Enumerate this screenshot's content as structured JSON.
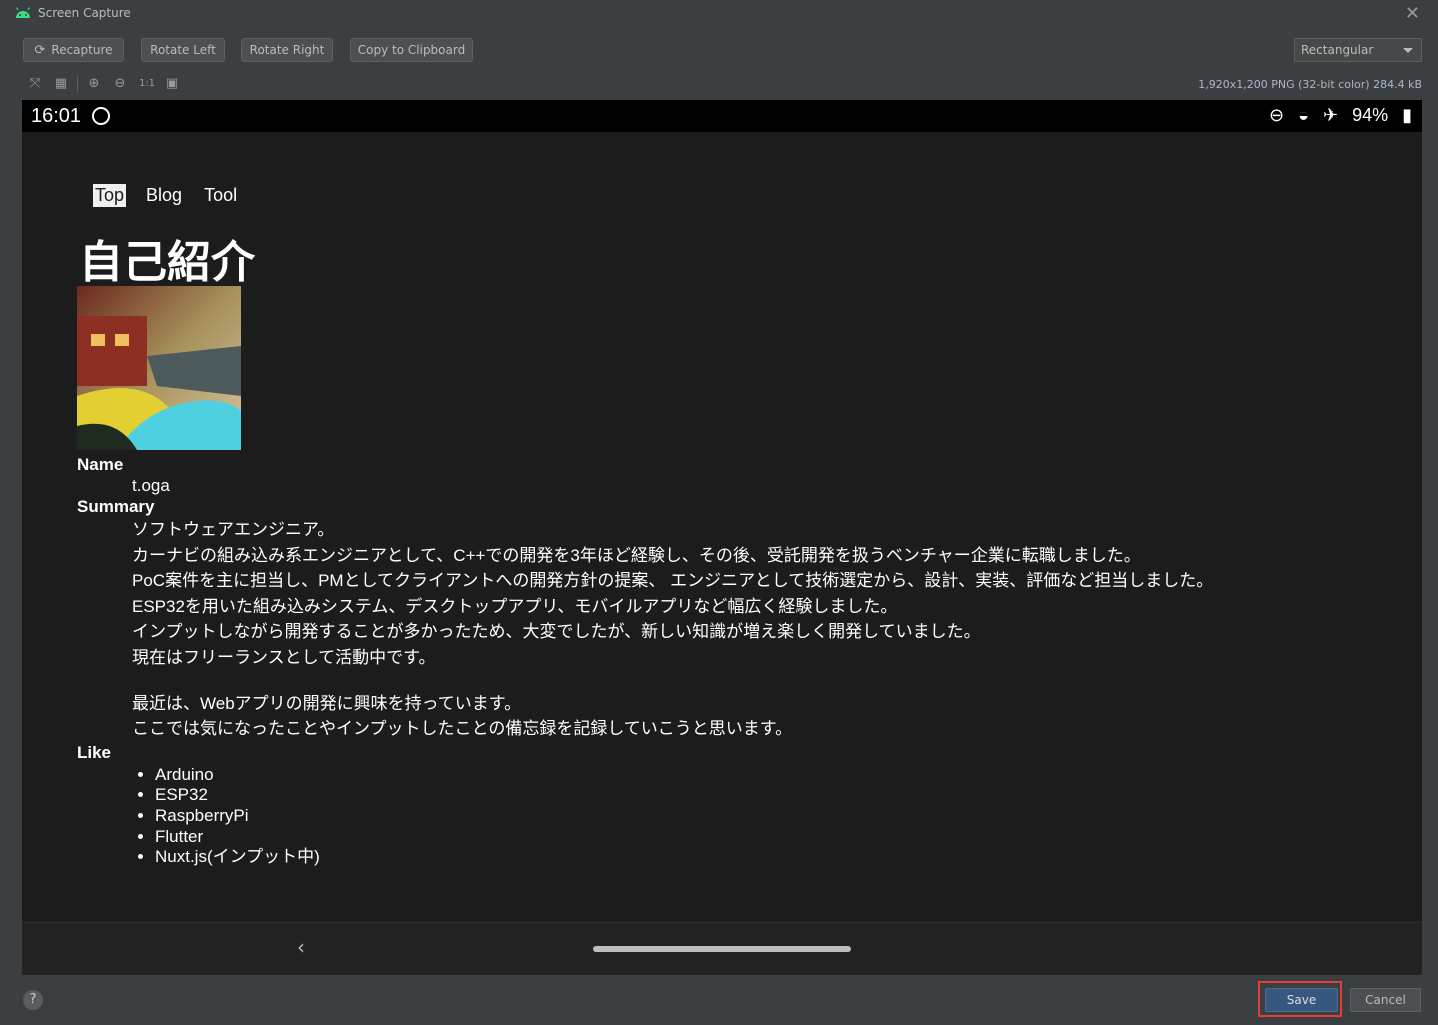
{
  "window": {
    "title": "Screen Capture",
    "close_glyph": "✕"
  },
  "toolbar": {
    "recapture_label": "Recapture",
    "rotate_left_label": "Rotate Left",
    "rotate_right_label": "Rotate Right",
    "copy_label": "Copy to Clipboard",
    "shape_select_value": "Rectangular"
  },
  "subtoolbar": {
    "icons": [
      "fit-screen-icon",
      "grid-icon",
      "zoom-in-icon",
      "zoom-out-icon",
      "actual-size-icon",
      "frame-icon"
    ],
    "actual_size_label": "1:1",
    "image_info": "1,920x1,200 PNG (32-bit color) 284.4 kB"
  },
  "device": {
    "status_bar": {
      "time": "16:01",
      "battery": "94%",
      "icons": [
        "dnd-icon",
        "wifi-icon",
        "airplane-icon",
        "battery-icon"
      ]
    },
    "page": {
      "nav": [
        "Top",
        "Blog",
        "Tool"
      ],
      "heading": "自己紹介",
      "name_label": "Name",
      "name_value": "t.oga",
      "summary_label": "Summary",
      "summary_lines": [
        "ソフトウェアエンジニア。",
        "カーナビの組み込み系エンジニアとして、C++での開発を3年ほど経験し、その後、受託開発を扱うベンチャー企業に転職しました。",
        "PoC案件を主に担当し、PMとしてクライアントへの開発方針の提案、 エンジニアとして技術選定から、設計、実装、評価など担当しました。",
        "ESP32を用いた組み込みシステム、デスクトップアプリ、モバイルアプリなど幅広く経験しました。",
        "インプットしながら開発することが多かったため、大変でしたが、新しい知識が増え楽しく開発していました。",
        "現在はフリーランスとして活動中です。",
        "",
        "最近は、Webアプリの開発に興味を持っています。",
        "ここでは気になったことやインプットしたことの備忘録を記録していこうと思います。"
      ],
      "like_label": "Like",
      "likes": [
        "Arduino",
        "ESP32",
        "RaspberryPi",
        "Flutter",
        "Nuxt.js(インプット中)"
      ]
    },
    "nav_bar": {
      "back_glyph": "‹"
    }
  },
  "footer": {
    "help_label": "?",
    "save_label": "Save",
    "cancel_label": "Cancel"
  }
}
